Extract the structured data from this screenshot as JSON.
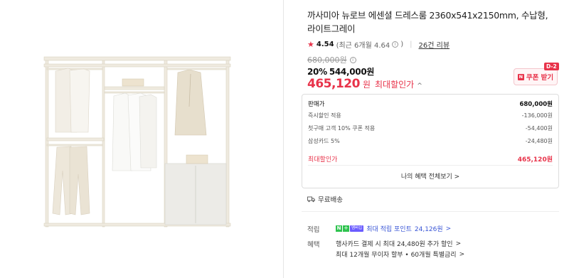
{
  "product": {
    "title": "까사미아 뉴로브 에센셜 드레스룸 2360x541x2150mm, 수납형, 라이트그레이",
    "rating": {
      "score": "4.54",
      "recent": "(최근 6개월 4.64",
      "recent_close": ")",
      "review_link": "26건 리뷰"
    },
    "original_price": "680,000원",
    "discount": {
      "pct": "20%",
      "price": "544,000원"
    },
    "max_discount": {
      "amount": "465,120",
      "won": "원",
      "label": "최대할인가",
      "toggle": "^"
    },
    "coupon": {
      "label": "쿠폰 받기",
      "dday": "D-2",
      "badge": "N"
    }
  },
  "breakdown": {
    "rows": [
      {
        "label": "판매가",
        "value": "680,000원"
      },
      {
        "label": "즉시할인 적용",
        "value": "-136,000원"
      },
      {
        "label": "첫구매 고객 10% 쿠폰 적용",
        "value": "-54,400원"
      },
      {
        "label": "삼성카드 5%",
        "value": "-24,480원"
      }
    ],
    "total": {
      "label": "최대할인가",
      "value": "465,120원"
    },
    "benefits_link": "나의 혜택 전체보기 >"
  },
  "shipping": {
    "label": "무료배송"
  },
  "points": {
    "label": "적립",
    "npay_n": "N",
    "npay_plus": "+",
    "npay_member": "멤버십",
    "text": "최대 적립 포인트",
    "amount": "24,126원",
    "chevron": ">"
  },
  "benefits": {
    "label": "혜택",
    "line1": "행사카드 결제 시 최대 24,480원 추가 할인",
    "line2": "최대 12개월 무이자 할부 • 60개월 특별금리",
    "chevron": ">"
  },
  "colors": {
    "accent": "#e8334a",
    "point_blue": "#3a56d6",
    "npay_green": "#2fc34f"
  }
}
